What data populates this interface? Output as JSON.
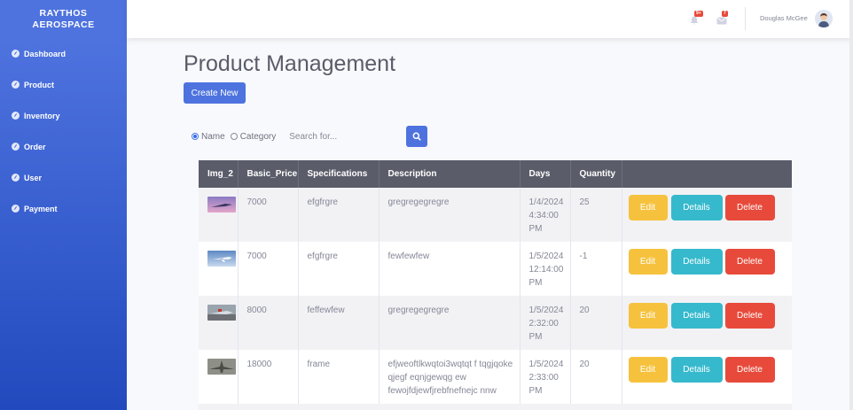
{
  "brand": {
    "line1": "RAYTHOS",
    "line2": "AEROSPACE"
  },
  "sidebar": {
    "items": [
      {
        "label": "Dashboard"
      },
      {
        "label": "Product"
      },
      {
        "label": "Inventory"
      },
      {
        "label": "Order"
      },
      {
        "label": "User"
      },
      {
        "label": "Payment"
      }
    ]
  },
  "topbar": {
    "alerts_badge": "9+",
    "messages_badge": "7",
    "user_name": "Douglas McGee"
  },
  "page": {
    "title": "Product Management",
    "create_button": "Create New"
  },
  "search": {
    "option_name": "Name",
    "option_category": "Category",
    "selected": "Name",
    "placeholder": "Search for..."
  },
  "table": {
    "headers": [
      "Img_2",
      "Basic_Price",
      "Specifications",
      "Description",
      "Days",
      "Quantity",
      ""
    ],
    "actions": {
      "edit": "Edit",
      "details": "Details",
      "delete": "Delete"
    },
    "rows": [
      {
        "price": "7000",
        "spec": "efgfrgre",
        "desc": "gregregegregre",
        "days": "1/4/2024 4:34:00 PM",
        "qty": "25"
      },
      {
        "price": "7000",
        "spec": "efgfrgre",
        "desc": "fewfewfew",
        "days": "1/5/2024 12:14:00 PM",
        "qty": "-1"
      },
      {
        "price": "8000",
        "spec": "feffewfew",
        "desc": "gregregegregre",
        "days": "1/5/2024 2:32:00 PM",
        "qty": "20"
      },
      {
        "price": "18000",
        "spec": "frame",
        "desc": "efjweoftlkwqtoi3wqtqt f tqgjqoke qjegf eqnjgewqg ew fewojfdjewfjrebfnefnejc nnw",
        "days": "1/5/2024 2:33:00 PM",
        "qty": "20"
      }
    ]
  },
  "colors": {
    "primary": "#4e73df",
    "warning": "#f6c23e",
    "info": "#36b9cc",
    "danger": "#e74a3b",
    "table_header": "#5a5c69"
  }
}
